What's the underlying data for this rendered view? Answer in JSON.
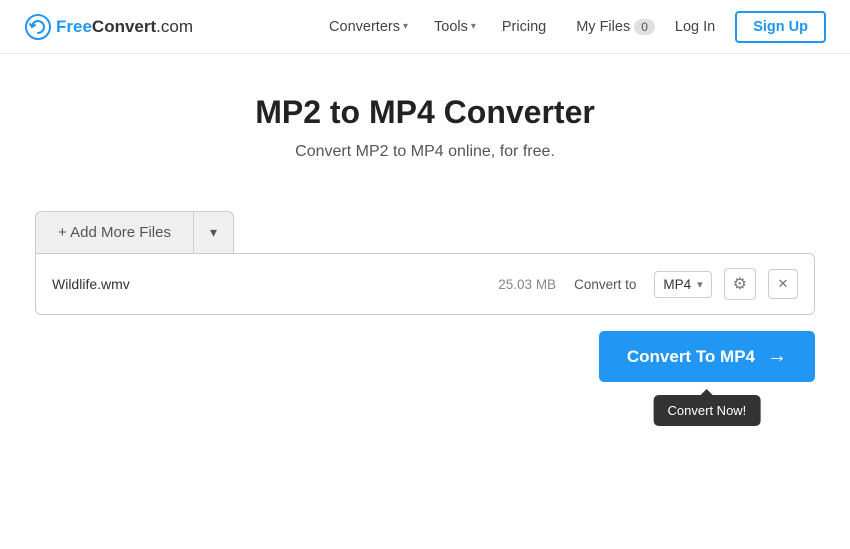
{
  "brand": {
    "free": "Free",
    "convert": "Convert",
    "domain": ".com"
  },
  "nav": {
    "converters": "Converters",
    "tools": "Tools",
    "pricing": "Pricing",
    "my_files": "My Files",
    "files_count": "0",
    "login": "Log In",
    "signup": "Sign Up"
  },
  "hero": {
    "title": "MP2 to MP4 Converter",
    "subtitle": "Convert MP2 to MP4 online, for free."
  },
  "upload": {
    "add_files_label": "+ Add More Files",
    "file_name": "Wildlife.wmv",
    "file_size": "25.03 MB",
    "convert_to_label": "Convert to",
    "format": "MP4",
    "convert_btn": "Convert To MP4",
    "tooltip": "Convert Now!"
  }
}
